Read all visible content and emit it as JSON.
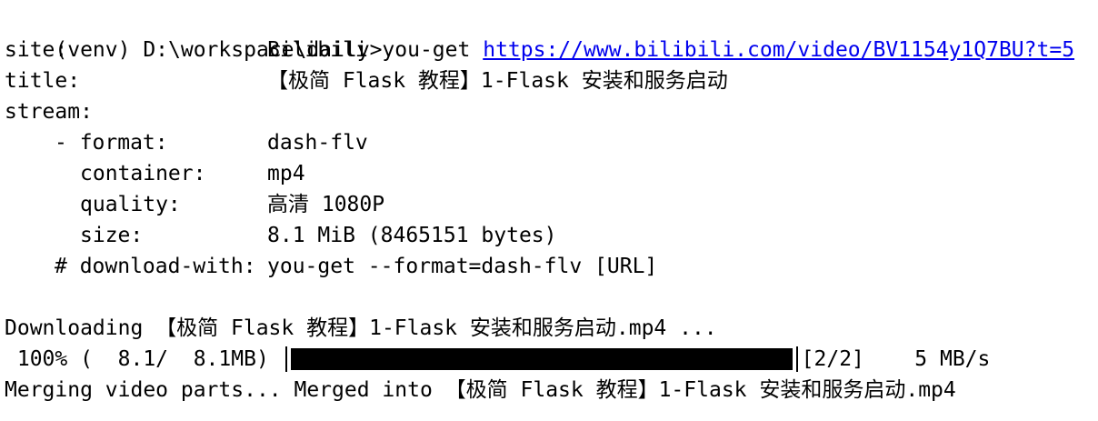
{
  "prompt": {
    "prefix": "(venv) D:\\workspace\\daily>",
    "command": "you-get",
    "url": "https://www.bilibili.com/video/BV1154y1Q7BU?t=5"
  },
  "info": {
    "site_key": "site:",
    "site_value": "Bilibili",
    "title_key": "title:",
    "title_value": "【极简 Flask 教程】1-Flask 安装和服务启动",
    "stream_key": "stream:",
    "format_key": "- format:",
    "format_value": "dash-flv",
    "container_key": "container:",
    "container_value": "mp4",
    "quality_key": "quality:",
    "quality_value": "高清 1080P",
    "size_key": "size:",
    "size_value": "8.1 MiB (8465151 bytes)",
    "download_key": "# download-with:",
    "download_value": "you-get --format=dash-flv [URL]"
  },
  "download": {
    "downloading_line": "Downloading 【极简 Flask 教程】1-Flask 安装和服务启动.mp4 ...",
    "percent_text": " 100% (  8.1/  8.1MB)",
    "progress_fraction": 1.0,
    "parts_text": "[2/2]",
    "speed_text": "    5 MB/s",
    "merge_line": "Merging video parts... Merged into 【极简 Flask 教程】1-Flask 安装和服务启动.mp4"
  }
}
